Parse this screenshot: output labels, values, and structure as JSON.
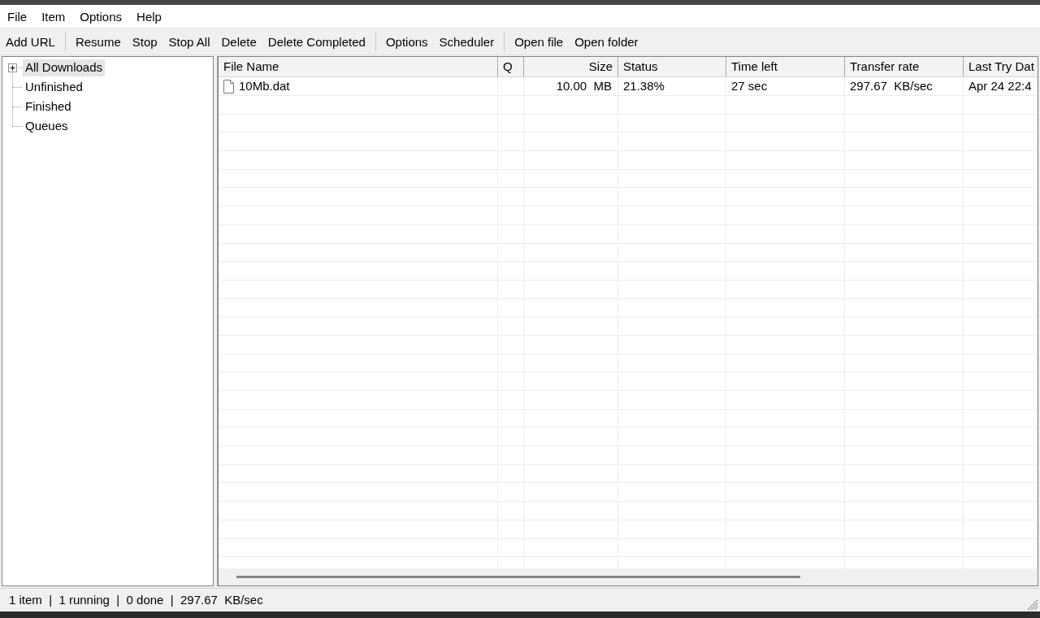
{
  "menu": [
    "File",
    "Item",
    "Options",
    "Help"
  ],
  "toolbar": {
    "groups": [
      {
        "buttons": [
          "Add URL"
        ]
      },
      {
        "buttons": [
          "Resume",
          "Stop",
          "Stop All",
          "Delete",
          "Delete Completed"
        ]
      },
      {
        "buttons": [
          "Options",
          "Scheduler"
        ]
      },
      {
        "buttons": [
          "Open file",
          "Open folder"
        ]
      }
    ]
  },
  "tree": [
    {
      "label": "All Downloads",
      "kind": "group",
      "expanded": false,
      "selected": true
    },
    {
      "label": "Unfinished",
      "kind": "leaf",
      "selected": false
    },
    {
      "label": "Finished",
      "kind": "leaf",
      "selected": false
    },
    {
      "label": "Queues",
      "kind": "leaf",
      "selected": false
    }
  ],
  "table": {
    "columns": [
      {
        "label": "File Name",
        "kind": "text"
      },
      {
        "label": "Q",
        "kind": "text"
      },
      {
        "label": "Size",
        "kind": "number"
      },
      {
        "label": "Status",
        "kind": "text"
      },
      {
        "label": "Time left",
        "kind": "text"
      },
      {
        "label": "Transfer rate",
        "kind": "text"
      },
      {
        "label": "Last Try Dat",
        "kind": "text"
      }
    ],
    "rows": [
      {
        "selected": false,
        "file_name": "10Mb.dat",
        "size": "10.00  MB",
        "status": "21.38%",
        "time_left": "27 sec",
        "transfer_rate": "297.67  KB/sec",
        "last_try_date": "Apr 24 22:4"
      }
    ]
  },
  "status_bar": {
    "text": "1 item  |  1 running  |  0 done  |  297.67  KB/sec"
  }
}
